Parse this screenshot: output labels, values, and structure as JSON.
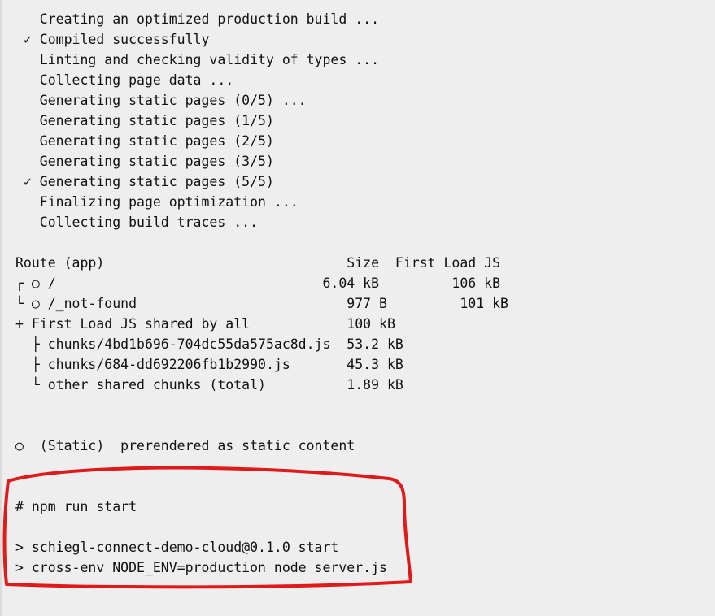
{
  "colors": {
    "background": "#eeeeee",
    "text": "#111111",
    "highlight_stroke": "#e0191b"
  },
  "build_output": [
    "   Creating an optimized production build ...",
    " ✓ Compiled successfully",
    "   Linting and checking validity of types ...",
    "   Collecting page data ...",
    "   Generating static pages (0/5) ...",
    "   Generating static pages (1/5)",
    "   Generating static pages (2/5)",
    "   Generating static pages (3/5)",
    " ✓ Generating static pages (5/5)",
    "   Finalizing page optimization ...",
    "   Collecting build traces ..."
  ],
  "route_table": [
    "Route (app)                              Size  First Load JS",
    "┌ ○ /                                 6.04 kB         106 kB",
    "└ ○ /_not-found                          977 B         101 kB",
    "+ First Load JS shared by all            100 kB",
    "  ├ chunks/4bd1b696-704dc55da575ac8d.js  53.2 kB",
    "  ├ chunks/684-dd692206fb1b2990.js       45.3 kB",
    "  └ other shared chunks (total)          1.89 kB"
  ],
  "legend_line": "○  (Static)  prerendered as static content",
  "start_command": [
    "# npm run start",
    "",
    "> schiegl-connect-demo-cloud@0.1.0 start",
    "> cross-env NODE_ENV=production node server.js"
  ]
}
